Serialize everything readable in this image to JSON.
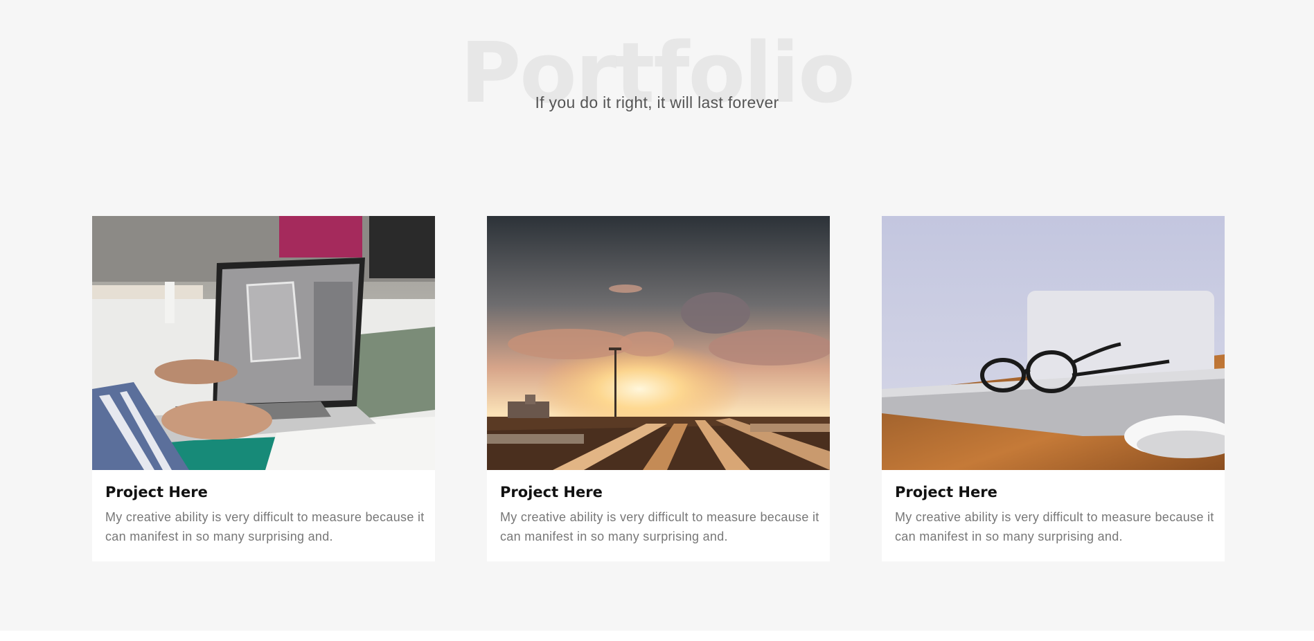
{
  "portfolio": {
    "title": "Portfolio",
    "subtitle": "If you do it right, it will last forever"
  },
  "cards": [
    {
      "title": "Project Here",
      "text": "My creative ability is very difficult to measure because it can manifest in so many surprising and.",
      "image": "laptop-design-photo"
    },
    {
      "title": "Project Here",
      "text": "My creative ability is very difficult to measure because it can manifest in so many surprising and.",
      "image": "railway-sunset-photo"
    },
    {
      "title": "Project Here",
      "text": "My creative ability is very difficult to measure because it can manifest in so many surprising and.",
      "image": "glasses-on-laptop-photo"
    }
  ],
  "colors": {
    "background": "#f6f6f6",
    "card": "#ffffff",
    "title_watermark": "#e7e7e7",
    "heading": "#111111",
    "body_text": "#777777"
  }
}
